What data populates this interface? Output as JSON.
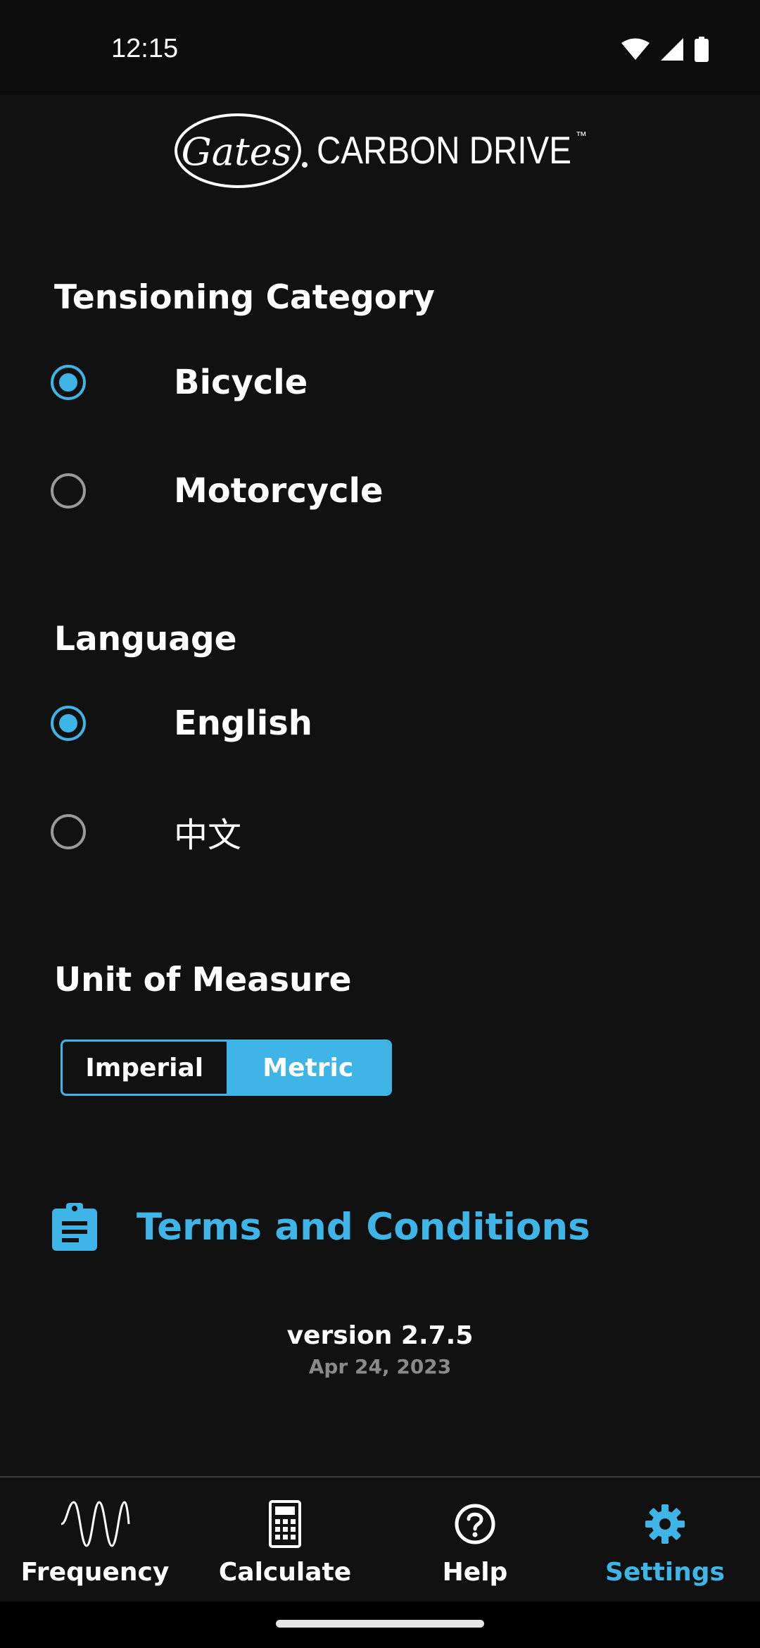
{
  "status_bar": {
    "time": "12:15"
  },
  "logo": {
    "brand": "Gates",
    "product": "CARBON DRIVE",
    "trademark": "™"
  },
  "tensioning": {
    "title": "Tensioning Category",
    "options": [
      {
        "label": "Bicycle",
        "selected": true
      },
      {
        "label": "Motorcycle",
        "selected": false
      }
    ]
  },
  "language": {
    "title": "Language",
    "options": [
      {
        "label": "English",
        "selected": true
      },
      {
        "label": "中文",
        "selected": false
      }
    ]
  },
  "units": {
    "title": "Unit of Measure",
    "options": [
      "Imperial",
      "Metric"
    ],
    "selected": "Metric"
  },
  "terms": {
    "label": "Terms and Conditions",
    "icon": "clipboard-icon"
  },
  "version": {
    "label": "version 2.7.5",
    "date": "Apr 24, 2023"
  },
  "nav": {
    "items": [
      {
        "label": "Frequency",
        "icon": "sine-wave-icon",
        "active": false
      },
      {
        "label": "Calculate",
        "icon": "calculator-icon",
        "active": false
      },
      {
        "label": "Help",
        "icon": "help-circle-icon",
        "active": false
      },
      {
        "label": "Settings",
        "icon": "gear-icon",
        "active": true
      }
    ]
  },
  "colors": {
    "accent": "#3fb4e6",
    "background": "#111111",
    "status_bar": "#0c0c0c",
    "text": "#ffffff",
    "muted": "#8a8a8a"
  }
}
